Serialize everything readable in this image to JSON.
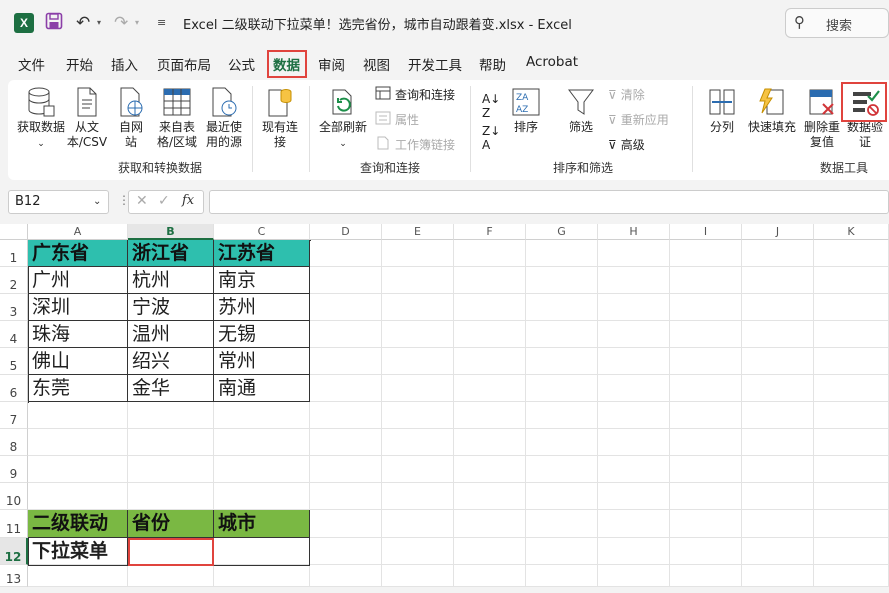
{
  "titlebar": {
    "logo": "X",
    "undo_icon": "undo-icon",
    "redo_icon": "redo-icon",
    "title": "Excel 二级联动下拉菜单！选完省份，城市自动跟着变.xlsx  -  Excel",
    "search_label": "搜索"
  },
  "menu": [
    "文件",
    "开始",
    "插入",
    "页面布局",
    "公式",
    "数据",
    "审阅",
    "视图",
    "开发工具",
    "帮助",
    "Acrobat"
  ],
  "ribbon": {
    "get_data": "获取数据",
    "from_csv": "从文本/CSV",
    "from_web": "自网站",
    "from_table": "来自表格/区域",
    "recent": "最近使用的源",
    "existing": "现有连接",
    "group1": "获取和转换数据",
    "refresh_all": "全部刷新",
    "queries": "查询和连接",
    "properties": "属性",
    "edit_links": "工作簿链接",
    "group2": "查询和连接",
    "sort": "排序",
    "filter": "筛选",
    "clear": "清除",
    "reapply": "重新应用",
    "advanced": "高级",
    "group3": "排序和筛选",
    "split": "分列",
    "flash_fill": "快速填充",
    "remove_dup": "删除重复值",
    "data_valid": "数据验证",
    "group4": "数据工具"
  },
  "formula_bar": {
    "name_box": "B12",
    "fx": "fx",
    "cancel": "✕",
    "enter": "✓"
  },
  "columns": [
    "A",
    "B",
    "C",
    "D",
    "E",
    "F",
    "G",
    "H",
    "I",
    "J",
    "K"
  ],
  "rows": [
    "1",
    "2",
    "3",
    "4",
    "5",
    "6",
    "7",
    "8",
    "9",
    "10",
    "11",
    "12",
    "13"
  ],
  "table1": {
    "headers": [
      "广东省",
      "浙江省",
      "江苏省"
    ],
    "rows": [
      [
        "广州",
        "杭州",
        "南京"
      ],
      [
        "深圳",
        "宁波",
        "苏州"
      ],
      [
        "珠海",
        "温州",
        "无锡"
      ],
      [
        "佛山",
        "绍兴",
        "常州"
      ],
      [
        "东莞",
        "金华",
        "南通"
      ]
    ]
  },
  "table2": {
    "headers": [
      "二级联动",
      "省份",
      "城市"
    ],
    "row_label": "下拉菜单",
    "province": "",
    "city": ""
  },
  "colors": {
    "accent_red": "#e0443e",
    "teal": "#2ebfae",
    "green": "#7ab843",
    "excel_green": "#1d6f42"
  }
}
